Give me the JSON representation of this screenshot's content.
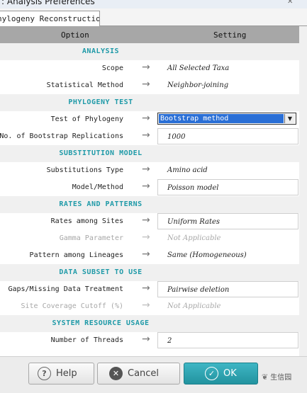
{
  "window": {
    "title": ": Analysis Preferences"
  },
  "tab": {
    "label": "hylogeny Reconstruction"
  },
  "columns": {
    "option": "Option",
    "setting": "Setting"
  },
  "sections": {
    "analysis": "ANALYSIS",
    "phylogeny_test": "PHYLOGENY TEST",
    "substitution_model": "SUBSTITUTION MODEL",
    "rates_patterns": "RATES AND PATTERNS",
    "data_subset": "DATA SUBSET TO USE",
    "system_resource": "SYSTEM RESOURCE USAGE"
  },
  "rows": {
    "scope": {
      "label": "Scope",
      "value": "All Selected Taxa"
    },
    "statistical_method": {
      "label": "Statistical Method",
      "value": "Neighbor-joining"
    },
    "test_of_phylogeny": {
      "label": "Test of Phylogeny",
      "value": "Bootstrap method"
    },
    "bootstrap_reps": {
      "label": "No. of Bootstrap Replications",
      "value": "1000"
    },
    "substitutions_type": {
      "label": "Substitutions Type",
      "value": "Amino acid"
    },
    "model_method": {
      "label": "Model/Method",
      "value": "Poisson model"
    },
    "rates_among_sites": {
      "label": "Rates among Sites",
      "value": "Uniform Rates"
    },
    "gamma_parameter": {
      "label": "Gamma Parameter",
      "value": "Not Applicable"
    },
    "pattern_lineages": {
      "label": "Pattern among Lineages",
      "value": "Same (Homogeneous)"
    },
    "gaps_missing": {
      "label": "Gaps/Missing Data Treatment",
      "value": "Pairwise deletion"
    },
    "site_coverage": {
      "label": "Site Coverage Cutoff (%)",
      "value": "Not Applicable"
    },
    "threads": {
      "label": "Number of Threads",
      "value": "2"
    }
  },
  "arrow_glyph": "→",
  "buttons": {
    "help": "Help",
    "cancel": "Cancel",
    "ok": "OK"
  },
  "watermark": {
    "text": "生信园"
  },
  "colors": {
    "section_text": "#1f9aa8",
    "ok_button": "#2aa3b1",
    "select_highlight": "#2a6fd6"
  }
}
